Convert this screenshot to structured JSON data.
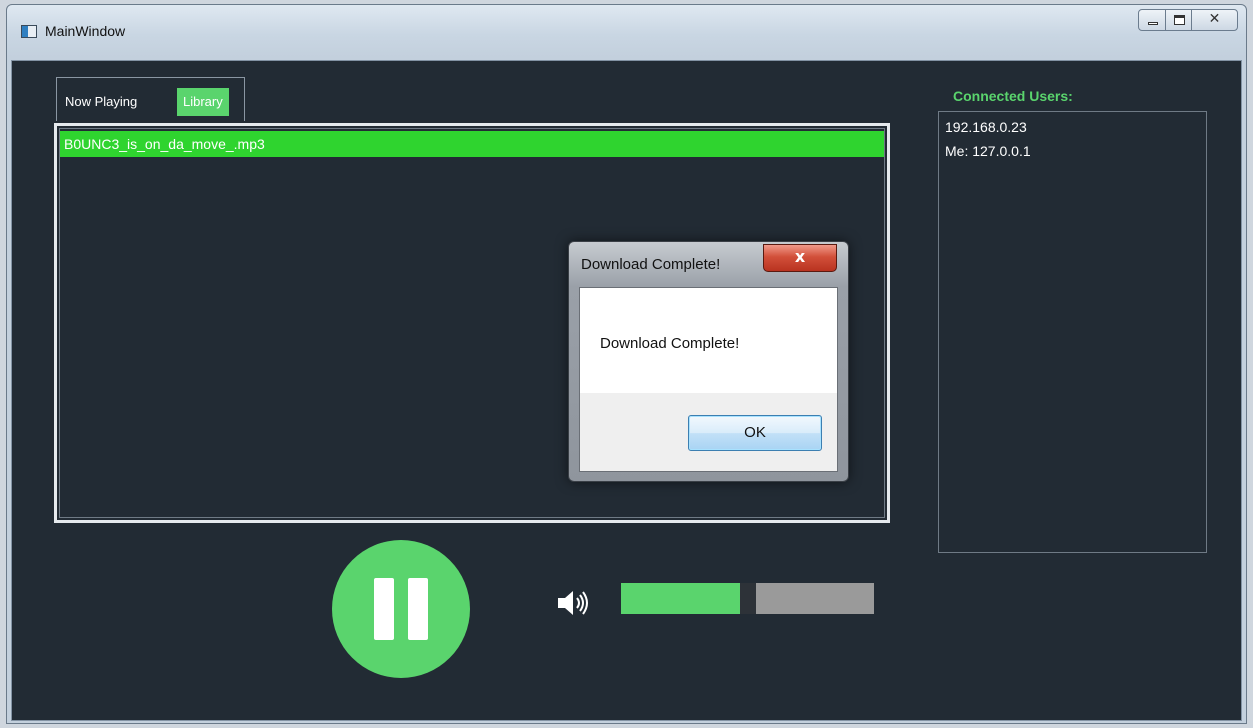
{
  "window": {
    "title": "MainWindow",
    "caption": {
      "minimize": "",
      "maximize": "",
      "close": "✕"
    }
  },
  "tabs": [
    {
      "label": "Now Playing",
      "active": false
    },
    {
      "label": "Library",
      "active": true
    }
  ],
  "library": {
    "tracks": [
      {
        "filename": "B0UNC3_is_on_da_move_.mp3",
        "selected": true
      }
    ]
  },
  "users": {
    "label": "Connected Users:",
    "items": [
      "192.168.0.23",
      "Me: 127.0.0.1"
    ]
  },
  "player": {
    "state": "playing",
    "pause_icon": "pause-icon",
    "volume_fraction": 0.47
  },
  "dialog": {
    "title": "Download Complete!",
    "message": "Download Complete!",
    "ok_label": "OK",
    "close_glyph": "x"
  },
  "colors": {
    "accent": "#5ad46d",
    "selection": "#2fd42f",
    "background": "#222b34"
  }
}
